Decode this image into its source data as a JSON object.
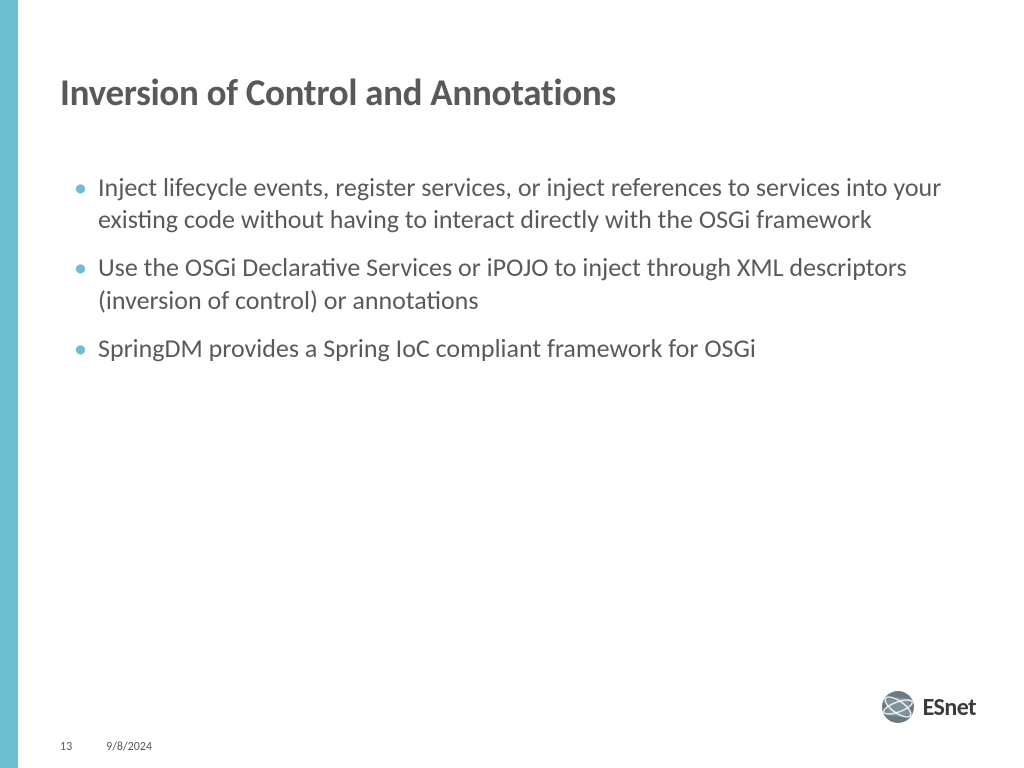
{
  "slide": {
    "title": "Inversion of Control and Annotations",
    "bullets": [
      "Inject lifecycle events, register services, or inject references to services into your existing code without having to interact directly with the OSGi framework",
      "Use the OSGi Declarative Services or iPOJO to inject through XML descriptors (inversion of control) or annotations",
      "SpringDM provides a Spring IoC compliant framework for OSGi"
    ]
  },
  "footer": {
    "slideNumber": "13",
    "date": "9/8/2024"
  },
  "logo": {
    "name": "ESnet"
  }
}
